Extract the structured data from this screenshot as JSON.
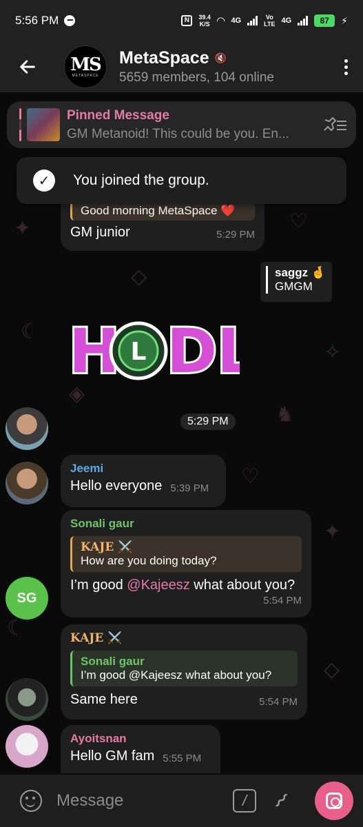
{
  "status_bar": {
    "time": "5:56 PM",
    "speed_value": "39.4",
    "speed_unit": "K/S",
    "net1": "4G",
    "net2a": "Vo",
    "net2b": "LTE",
    "net3": "4G",
    "battery": "87"
  },
  "header": {
    "title": "MetaSpace",
    "subtitle": "5659 members, 104 online",
    "avatar_logo": "MS",
    "avatar_sub": "METASPACE"
  },
  "pinned": {
    "title": "Pinned Message",
    "text": "GM Metanoid! This could be you.  En..."
  },
  "toast": {
    "text": "You joined the group."
  },
  "messages": [
    {
      "reply_text": "Good morning MetaSpace ❤️",
      "text": "GM junior",
      "time": "5:29 PM"
    },
    {
      "reply_name": "saggz 🤞",
      "reply_text": "GMGM"
    },
    {
      "sticker_text": "HODL",
      "time": "5:29 PM"
    },
    {
      "sender": "Jeemi",
      "text": "Hello everyone",
      "time": "5:39 PM"
    },
    {
      "sender": "Sonali gaur",
      "reply_name": "KAJE ⚔️",
      "reply_text": "How are you doing today?",
      "text_before": "I’m good ",
      "mention": "@Kajeesz",
      "text_after": "  what about you?",
      "time": "5:54 PM",
      "avatar_initials": "SG"
    },
    {
      "sender": "KAJE ⚔️",
      "reply_name": "Sonali gaur",
      "reply_text": "I’m good @Kajeesz  what about you?",
      "text": "Same here",
      "time": "5:54 PM"
    },
    {
      "sender": "Ayoitsnan",
      "text": "Hello GM fam",
      "time": "5:55 PM"
    }
  ],
  "input": {
    "placeholder": "Message"
  },
  "colors": {
    "accent_pink": "#e57aaa",
    "sender_blue": "#5aa9e6",
    "sender_green": "#6fc36a",
    "sender_orange": "#f0b46a",
    "camera_button": "#e8608a"
  }
}
